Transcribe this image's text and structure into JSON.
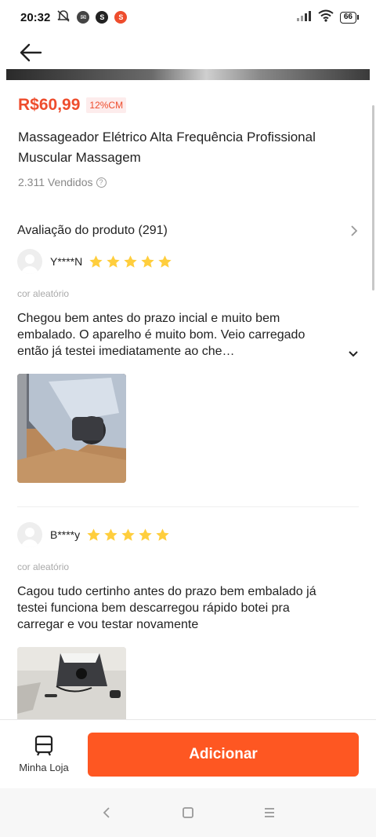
{
  "status_bar": {
    "time": "20:32",
    "battery": "66"
  },
  "product": {
    "price": "R$60,99",
    "discount": "12%CM",
    "title": "Massageador Elétrico Alta Frequência Profissional Muscular Massagem",
    "sold": "2.311 Vendidos"
  },
  "reviews": {
    "header": "Avaliação do produto (291)",
    "items": [
      {
        "user": "Y****N",
        "rating": 5,
        "variation": "cor aleatório",
        "text": "Chegou bem antes do prazo incial e muito bem embalado. O aparelho é muito bom. Veio carregado então já testei imediatamente ao che…"
      },
      {
        "user": "B****y",
        "rating": 5,
        "variation": "cor aleatório",
        "text": "Cagou tudo certinho antes do prazo bem embalado já testei funciona bem descarregou rápido botei pra carregar e vou testar novamente"
      }
    ]
  },
  "bottom_bar": {
    "store_label": "Minha Loja",
    "add_label": "Adicionar"
  },
  "colors": {
    "accent": "#ee4d2d",
    "button": "#fe5722",
    "star": "#ffce3d"
  },
  "icons": [
    "back-arrow-icon",
    "help-icon",
    "chevron-right-icon",
    "star-icon",
    "chevron-down-icon",
    "store-icon",
    "nav-back-icon",
    "nav-home-icon",
    "nav-menu-icon"
  ]
}
